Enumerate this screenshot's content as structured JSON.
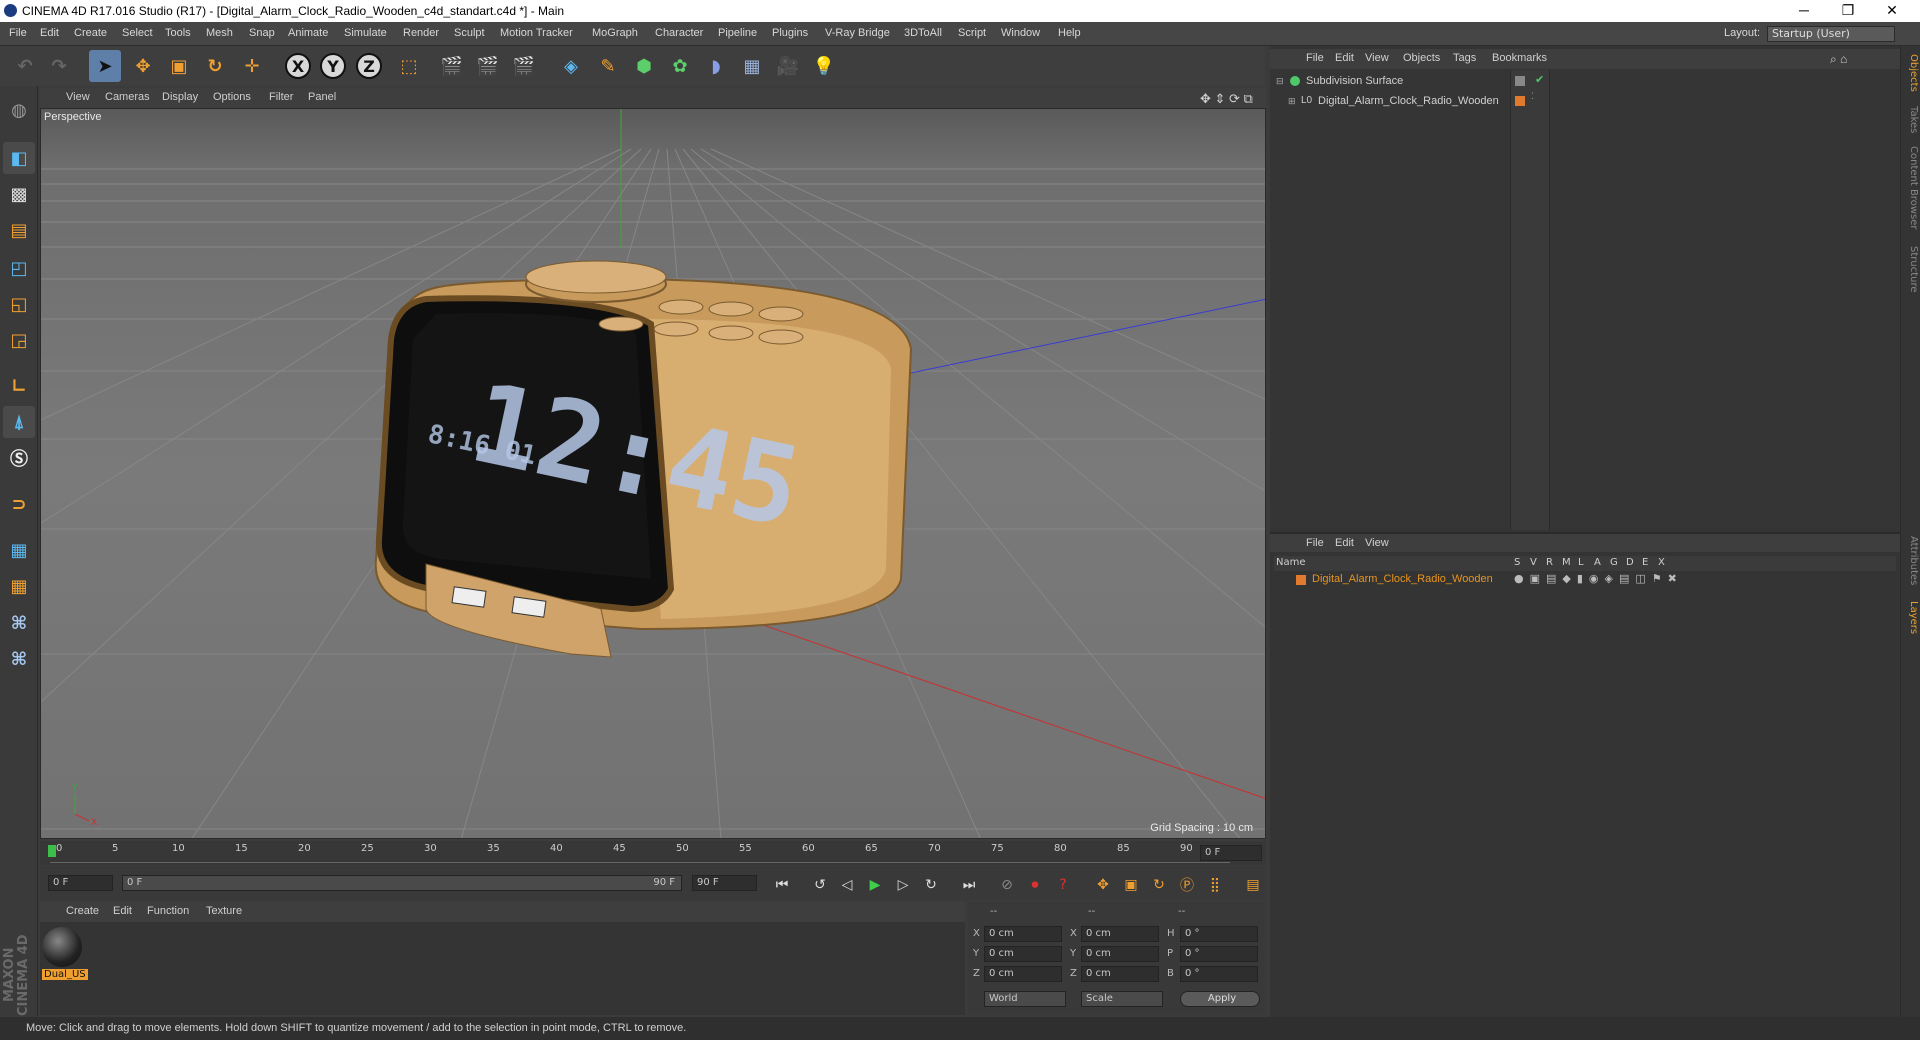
{
  "window": {
    "title": "CINEMA 4D R17.016 Studio (R17) - [Digital_Alarm_Clock_Radio_Wooden_c4d_standart.c4d *] - Main",
    "minimize": "─",
    "maximize": "❐",
    "close": "✕"
  },
  "menu": [
    "File",
    "Edit",
    "Create",
    "Select",
    "Tools",
    "Mesh",
    "Snap",
    "Animate",
    "Simulate",
    "Render",
    "Sculpt",
    "Motion Tracker",
    "MoGraph",
    "Character",
    "Pipeline",
    "Plugins",
    "V-Ray Bridge",
    "3DToAll",
    "Script",
    "Window",
    "Help"
  ],
  "layout": {
    "label": "Layout:",
    "value": "Startup (User)"
  },
  "toolbar": {
    "axis_x": "X",
    "axis_y": "Y",
    "axis_z": "Z"
  },
  "viewport": {
    "menu": [
      "View",
      "Cameras",
      "Display",
      "Options",
      "Filter",
      "Panel"
    ],
    "label": "Perspective",
    "grid_spacing": "Grid Spacing : 10 cm",
    "clock_time": "12:45",
    "clock_small": "8:16 01",
    "axis_y": "Y",
    "axis_x": "X"
  },
  "timeline": {
    "ticks": [
      "0",
      "5",
      "10",
      "15",
      "20",
      "25",
      "30",
      "35",
      "40",
      "45",
      "50",
      "55",
      "60",
      "65",
      "70",
      "75",
      "80",
      "85",
      "90"
    ],
    "end_field": "0 F"
  },
  "controls": {
    "start": "0 F",
    "range_start": "0 F",
    "range_end": "90 F",
    "end": "90 F"
  },
  "material_editor": {
    "menu": [
      "Create",
      "Edit",
      "Function",
      "Texture"
    ],
    "material_name": "Dual_US"
  },
  "coordinates": {
    "headers": [
      "--",
      "--",
      "--"
    ],
    "rows": [
      {
        "a": "X",
        "av": "0 cm",
        "b": "X",
        "bv": "0 cm",
        "c": "H",
        "cv": "0 °"
      },
      {
        "a": "Y",
        "av": "0 cm",
        "b": "Y",
        "bv": "0 cm",
        "c": "P",
        "cv": "0 °"
      },
      {
        "a": "Z",
        "av": "0 cm",
        "b": "Z",
        "bv": "0 cm",
        "c": "B",
        "cv": "0 °"
      }
    ],
    "mode1": "World",
    "mode2": "Scale",
    "apply": "Apply"
  },
  "object_manager": {
    "menu": [
      "File",
      "Edit",
      "View",
      "Objects",
      "Tags",
      "Bookmarks"
    ],
    "items": [
      {
        "name": "Subdivision Surface",
        "color": "#4ec86a"
      },
      {
        "name": "Digital_Alarm_Clock_Radio_Wooden",
        "color": "#e07a2e"
      }
    ]
  },
  "layer_manager": {
    "menu": [
      "File",
      "Edit",
      "View"
    ],
    "columns": [
      "Name",
      "S",
      "V",
      "R",
      "M",
      "L",
      "A",
      "G",
      "D",
      "E",
      "X"
    ],
    "layer_name": "Digital_Alarm_Clock_Radio_Wooden",
    "layer_color": "#e07a2e"
  },
  "side_tabs": [
    "Objects",
    "Takes",
    "Content Browser",
    "Structure",
    "Attributes",
    "Layers"
  ],
  "status": "Move: Click and drag to move elements. Hold down SHIFT to quantize movement / add to the selection in point mode, CTRL to remove."
}
